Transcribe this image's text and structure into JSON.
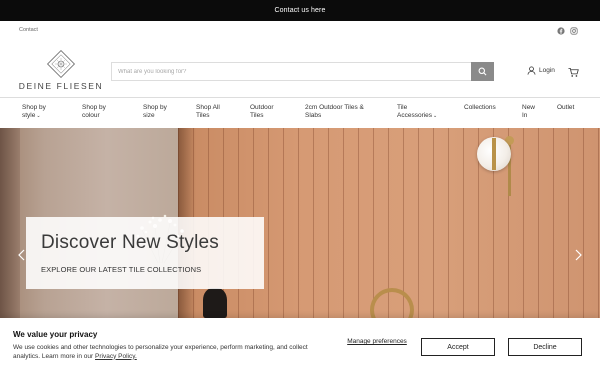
{
  "announcement": {
    "text": "Contact us here"
  },
  "utility": {
    "contact_label": "Contact",
    "social": [
      "facebook-icon",
      "instagram-icon"
    ]
  },
  "brand": {
    "logo_text": "DEINE FLIESEN"
  },
  "search": {
    "placeholder": "What are you looking for?",
    "value": ""
  },
  "account": {
    "login_label": "Login"
  },
  "nav": {
    "items": [
      {
        "line1": "Shop by",
        "line2": "style",
        "caret": "⌄"
      },
      {
        "line1": "Shop by",
        "line2": "colour",
        "caret": ""
      },
      {
        "line1": "Shop by",
        "line2": "size",
        "caret": ""
      },
      {
        "line1": "Shop All",
        "line2": "Tiles",
        "caret": ""
      },
      {
        "line1": "Outdoor",
        "line2": "Tiles",
        "caret": ""
      },
      {
        "line1": "2cm Outdoor Tiles &",
        "line2": "Slabs",
        "caret": ""
      },
      {
        "line1": "Tile",
        "line2": "Accessories",
        "caret": "⌄"
      },
      {
        "line1": "Collections",
        "line2": "",
        "caret": ""
      },
      {
        "line1": "New",
        "line2": "In",
        "caret": ""
      },
      {
        "line1": "Outlet",
        "line2": "",
        "caret": ""
      }
    ]
  },
  "hero": {
    "title": "Discover New Styles",
    "subtitle": "EXPLORE OUR LATEST TILE COLLECTIONS"
  },
  "cookie": {
    "title": "We value your privacy",
    "text_before": "We use cookies and other technologies to personalize your experience, perform marketing, and collect analytics. Learn more in our ",
    "link": "Privacy Policy.",
    "manage_label": "Manage preferences",
    "accept_label": "Accept",
    "decline_label": "Decline"
  },
  "colors": {
    "announcement_bg": "#0b0b0b",
    "search_button": "#8a8a8a",
    "tile": "#d39670"
  }
}
